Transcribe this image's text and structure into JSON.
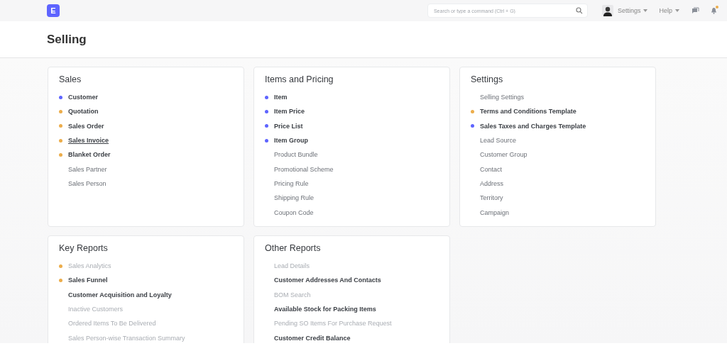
{
  "navbar": {
    "logo": "E",
    "search": {
      "placeholder": "Search or type a command (Ctrl + G)"
    },
    "menus": [
      {
        "label": "Settings",
        "kind": "user"
      },
      {
        "label": "Help",
        "kind": "plain"
      }
    ],
    "notifications": {
      "unread": true
    }
  },
  "page": {
    "title": "Selling"
  },
  "cards": [
    {
      "title": "Sales",
      "items": [
        {
          "label": "Customer",
          "color": "#5e64ff",
          "kind": "strong",
          "hovered": false
        },
        {
          "label": "Quotation",
          "color": "#ecad4b",
          "kind": "strong",
          "hovered": false
        },
        {
          "label": "Sales Order",
          "color": "#ecad4b",
          "kind": "strong",
          "hovered": false
        },
        {
          "label": "Sales Invoice",
          "color": "#ecad4b",
          "kind": "strong",
          "hovered": true
        },
        {
          "label": "Blanket Order",
          "color": "#ecad4b",
          "kind": "strong",
          "hovered": false
        },
        {
          "label": "Sales Partner",
          "kind": "plain",
          "hovered": false
        },
        {
          "label": "Sales Person",
          "kind": "plain",
          "hovered": false
        }
      ]
    },
    {
      "title": "Items and Pricing",
      "items": [
        {
          "label": "Item",
          "color": "#5e64ff",
          "kind": "strong",
          "hovered": false
        },
        {
          "label": "Item Price",
          "color": "#5e64ff",
          "kind": "strong",
          "hovered": false
        },
        {
          "label": "Price List",
          "color": "#5e64ff",
          "kind": "strong",
          "hovered": false
        },
        {
          "label": "Item Group",
          "color": "#5e64ff",
          "kind": "strong",
          "hovered": false
        },
        {
          "label": "Product Bundle",
          "kind": "plain",
          "hovered": false
        },
        {
          "label": "Promotional Scheme",
          "kind": "plain",
          "hovered": false
        },
        {
          "label": "Pricing Rule",
          "kind": "plain",
          "hovered": false
        },
        {
          "label": "Shipping Rule",
          "kind": "plain",
          "hovered": false
        },
        {
          "label": "Coupon Code",
          "kind": "plain",
          "hovered": false
        }
      ]
    },
    {
      "title": "Settings",
      "items": [
        {
          "label": "Selling Settings",
          "kind": "plain",
          "hovered": false
        },
        {
          "label": "Terms and Conditions Template",
          "color": "#ecad4b",
          "kind": "strong",
          "hovered": false
        },
        {
          "label": "Sales Taxes and Charges Template",
          "color": "#5e64ff",
          "kind": "strong",
          "hovered": false
        },
        {
          "label": "Lead Source",
          "kind": "plain",
          "hovered": false
        },
        {
          "label": "Customer Group",
          "kind": "plain",
          "hovered": false
        },
        {
          "label": "Contact",
          "kind": "plain",
          "hovered": false
        },
        {
          "label": "Address",
          "kind": "plain",
          "hovered": false
        },
        {
          "label": "Territory",
          "kind": "plain",
          "hovered": false
        },
        {
          "label": "Campaign",
          "kind": "plain",
          "hovered": false
        }
      ]
    },
    {
      "title": "Key Reports",
      "items": [
        {
          "label": "Sales Analytics",
          "color": "#ecad4b",
          "kind": "faded",
          "hovered": false
        },
        {
          "label": "Sales Funnel",
          "color": "#ecad4b",
          "kind": "strong",
          "hovered": false
        },
        {
          "label": "Customer Acquisition and Loyalty",
          "kind": "strong",
          "hovered": false
        },
        {
          "label": "Inactive Customers",
          "kind": "faded",
          "hovered": false
        },
        {
          "label": "Ordered Items To Be Delivered",
          "kind": "faded",
          "hovered": false
        },
        {
          "label": "Sales Person-wise Transaction Summary",
          "kind": "faded",
          "hovered": false
        }
      ]
    },
    {
      "title": "Other Reports",
      "items": [
        {
          "label": "Lead Details",
          "kind": "faded",
          "hovered": false
        },
        {
          "label": "Customer Addresses And Contacts",
          "kind": "strong",
          "hovered": false
        },
        {
          "label": "BOM Search",
          "kind": "faded",
          "hovered": false
        },
        {
          "label": "Available Stock for Packing Items",
          "kind": "strong",
          "hovered": false
        },
        {
          "label": "Pending SO Items For Purchase Request",
          "kind": "faded",
          "hovered": false
        },
        {
          "label": "Customer Credit Balance",
          "kind": "strong",
          "hovered": false
        }
      ]
    }
  ]
}
